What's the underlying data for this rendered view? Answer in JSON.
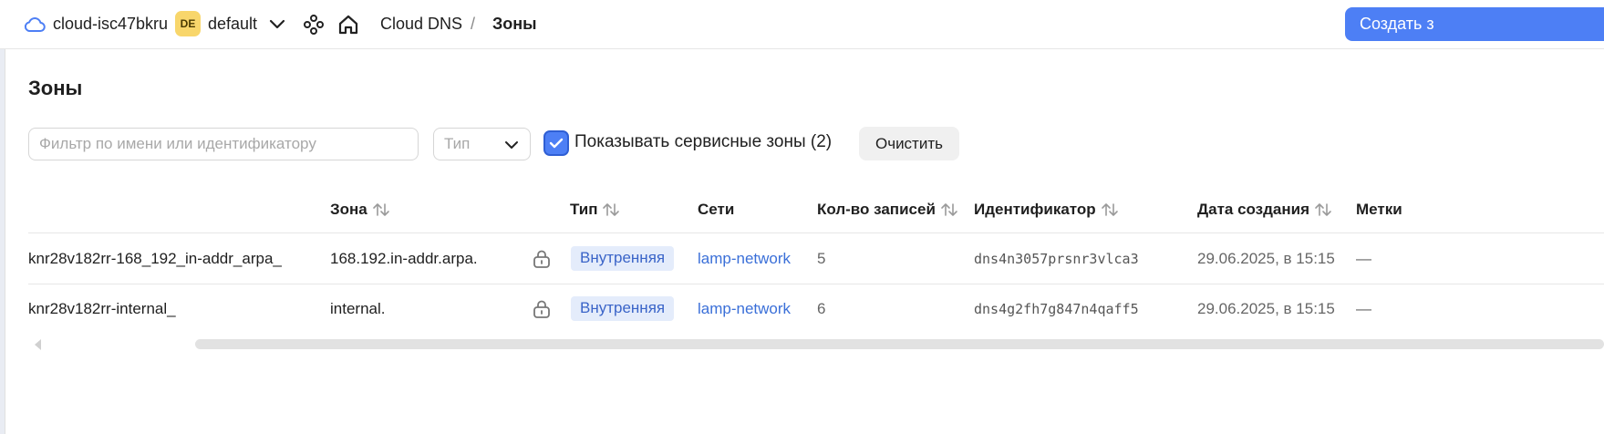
{
  "header": {
    "cloud_name": "cloud-isc47bkru",
    "folder_badge": "DE",
    "folder_name": "default",
    "breadcrumb": {
      "service": "Cloud DNS",
      "separator": "/",
      "current": "Зоны"
    },
    "create_button_label": "Создать з",
    "icons": [
      "cloud-icon",
      "chevron-down-icon",
      "services-icon",
      "home-icon"
    ]
  },
  "page": {
    "title": "Зоны"
  },
  "filters": {
    "search_placeholder": "Фильтр по имени или идентификатору",
    "type_placeholder": "Тип",
    "show_service_zones_label": "Показывать сервисные зоны (2)",
    "show_service_zones_checked": true,
    "clear_button_label": "Очистить"
  },
  "table": {
    "columns": [
      "Зона",
      "Тип",
      "Сети",
      "Кол-во записей",
      "Идентификатор",
      "Дата создания",
      "Метки"
    ],
    "rows": [
      {
        "name": "knr28v182rr-168_192_in-addr_arpa_",
        "zone": "168.192.in-addr.arpa.",
        "type": "Внутренняя",
        "network": "lamp-network",
        "records": "5",
        "id": "dns4n3057prsnr3vlca3",
        "created": "29.06.2025, в 15:15",
        "labels": "—"
      },
      {
        "name": "knr28v182rr-internal_",
        "zone": "internal.",
        "type": "Внутренняя",
        "network": "lamp-network",
        "records": "6",
        "id": "dns4g2fh7g847n4qaff5",
        "created": "29.06.2025, в 15:15",
        "labels": "—"
      }
    ]
  },
  "colors": {
    "accent": "#4d7ff5",
    "badge": "#f8d66b",
    "tag_bg": "#e4ecfb",
    "link": "#3a6fd8"
  }
}
